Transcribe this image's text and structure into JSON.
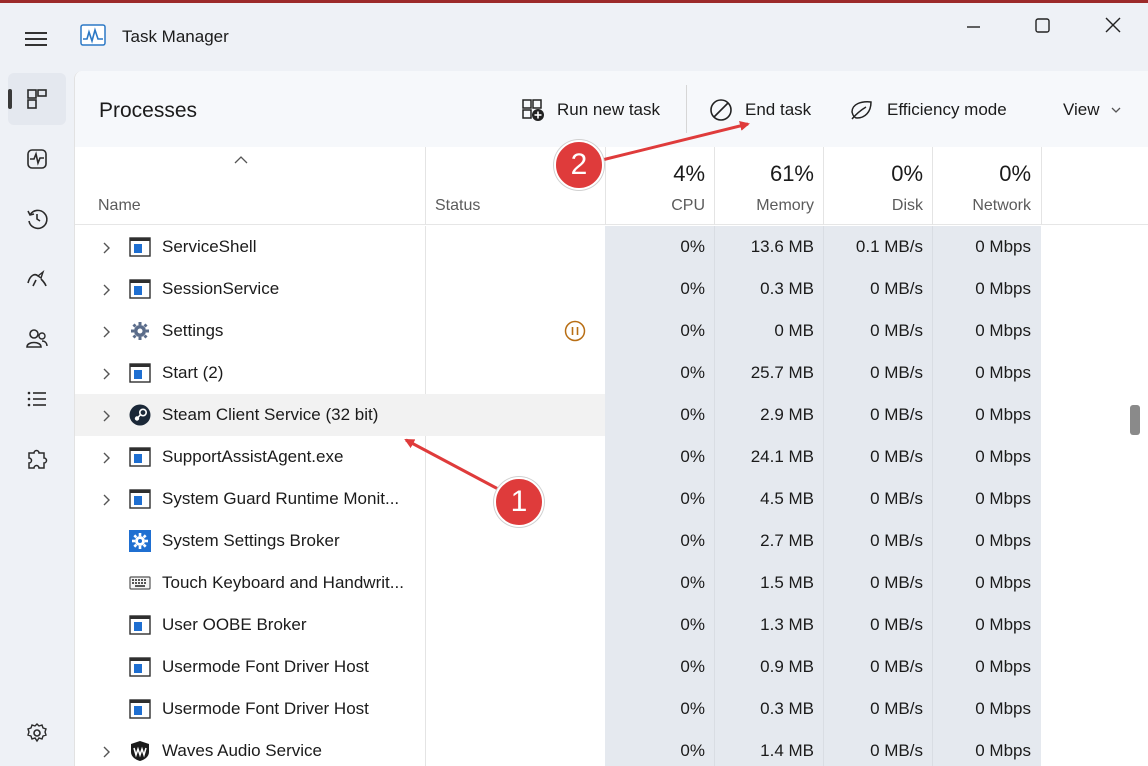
{
  "window": {
    "title": "Task Manager"
  },
  "toolbar": {
    "page_title": "Processes",
    "run_new_task": "Run new task",
    "end_task": "End task",
    "efficiency_mode": "Efficiency mode",
    "view": "View"
  },
  "columns": {
    "name": "Name",
    "status": "Status",
    "cpu_pct": "4%",
    "cpu": "CPU",
    "memory_pct": "61%",
    "memory": "Memory",
    "disk_pct": "0%",
    "disk": "Disk",
    "network_pct": "0%",
    "network": "Network"
  },
  "processes": [
    {
      "name": "ServiceShell",
      "cpu": "0%",
      "memory": "13.6 MB",
      "disk": "0.1 MB/s",
      "network": "0 Mbps",
      "icon": "window-app-icon",
      "expandable": true
    },
    {
      "name": "SessionService",
      "cpu": "0%",
      "memory": "0.3 MB",
      "disk": "0 MB/s",
      "network": "0 Mbps",
      "icon": "window-app-icon",
      "expandable": true
    },
    {
      "name": "Settings",
      "cpu": "0%",
      "memory": "0 MB",
      "disk": "0 MB/s",
      "network": "0 Mbps",
      "icon": "gear-icon",
      "expandable": true,
      "status": "paused-icon"
    },
    {
      "name": "Start (2)",
      "cpu": "0%",
      "memory": "25.7 MB",
      "disk": "0 MB/s",
      "network": "0 Mbps",
      "icon": "window-app-icon",
      "expandable": true
    },
    {
      "name": "Steam Client Service (32 bit)",
      "cpu": "0%",
      "memory": "2.9 MB",
      "disk": "0 MB/s",
      "network": "0 Mbps",
      "icon": "steam-icon",
      "expandable": true,
      "hover": true
    },
    {
      "name": "SupportAssistAgent.exe",
      "cpu": "0%",
      "memory": "24.1 MB",
      "disk": "0 MB/s",
      "network": "0 Mbps",
      "icon": "window-app-icon",
      "expandable": true
    },
    {
      "name": "System Guard Runtime Monit...",
      "cpu": "0%",
      "memory": "4.5 MB",
      "disk": "0 MB/s",
      "network": "0 Mbps",
      "icon": "window-app-icon",
      "expandable": true
    },
    {
      "name": "System Settings Broker",
      "cpu": "0%",
      "memory": "2.7 MB",
      "disk": "0 MB/s",
      "network": "0 Mbps",
      "icon": "blue-gear-icon",
      "expandable": false
    },
    {
      "name": "Touch Keyboard and Handwrit...",
      "cpu": "0%",
      "memory": "1.5 MB",
      "disk": "0 MB/s",
      "network": "0 Mbps",
      "icon": "keyboard-icon",
      "expandable": false
    },
    {
      "name": "User OOBE Broker",
      "cpu": "0%",
      "memory": "1.3 MB",
      "disk": "0 MB/s",
      "network": "0 Mbps",
      "icon": "window-app-icon",
      "expandable": false
    },
    {
      "name": "Usermode Font Driver Host",
      "cpu": "0%",
      "memory": "0.9 MB",
      "disk": "0 MB/s",
      "network": "0 Mbps",
      "icon": "window-app-icon",
      "expandable": false
    },
    {
      "name": "Usermode Font Driver Host",
      "cpu": "0%",
      "memory": "0.3 MB",
      "disk": "0 MB/s",
      "network": "0 Mbps",
      "icon": "window-app-icon",
      "expandable": false
    },
    {
      "name": "Waves Audio Service",
      "cpu": "0%",
      "memory": "1.4 MB",
      "disk": "0 MB/s",
      "network": "0 Mbps",
      "icon": "waves-icon",
      "expandable": true
    }
  ],
  "annotations": {
    "badge_1": "1",
    "badge_2": "2",
    "color": "#df3b3b"
  }
}
